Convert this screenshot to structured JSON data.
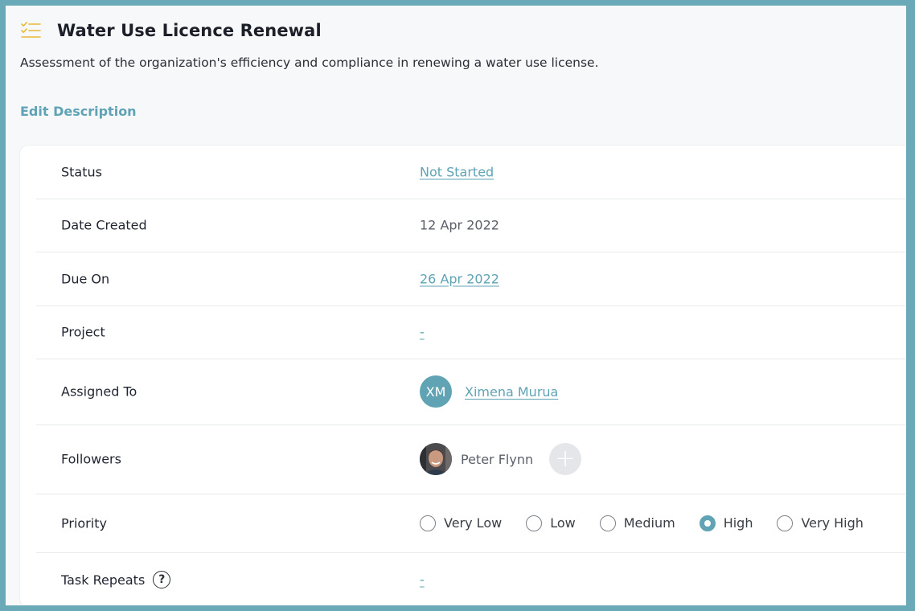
{
  "header": {
    "title": "Water Use Licence Renewal",
    "description": "Assessment of the organization's efficiency and compliance in renewing a water use license.",
    "edit_label": "Edit Description"
  },
  "fields": {
    "status": {
      "label": "Status",
      "value": "Not Started"
    },
    "date_created": {
      "label": "Date Created",
      "value": "12 Apr 2022"
    },
    "due_on": {
      "label": "Due On",
      "value": "26 Apr 2022"
    },
    "project": {
      "label": "Project",
      "value": "-"
    },
    "assigned_to": {
      "label": "Assigned To",
      "initials": "XM",
      "name": "Ximena Murua"
    },
    "followers": {
      "label": "Followers",
      "items": [
        {
          "name": "Peter Flynn"
        }
      ],
      "add_symbol": "+"
    },
    "priority": {
      "label": "Priority",
      "options": [
        "Very Low",
        "Low",
        "Medium",
        "High",
        "Very High"
      ],
      "selected": "High"
    },
    "task_repeats": {
      "label": "Task Repeats",
      "help_symbol": "?",
      "value": "-"
    }
  },
  "colors": {
    "accent": "#5fa3b5",
    "frame": "#6aa9b8",
    "icon": "#e8b83a"
  },
  "icons": {
    "task": "checklist-icon",
    "help": "question-circle-icon",
    "add": "plus-icon"
  }
}
